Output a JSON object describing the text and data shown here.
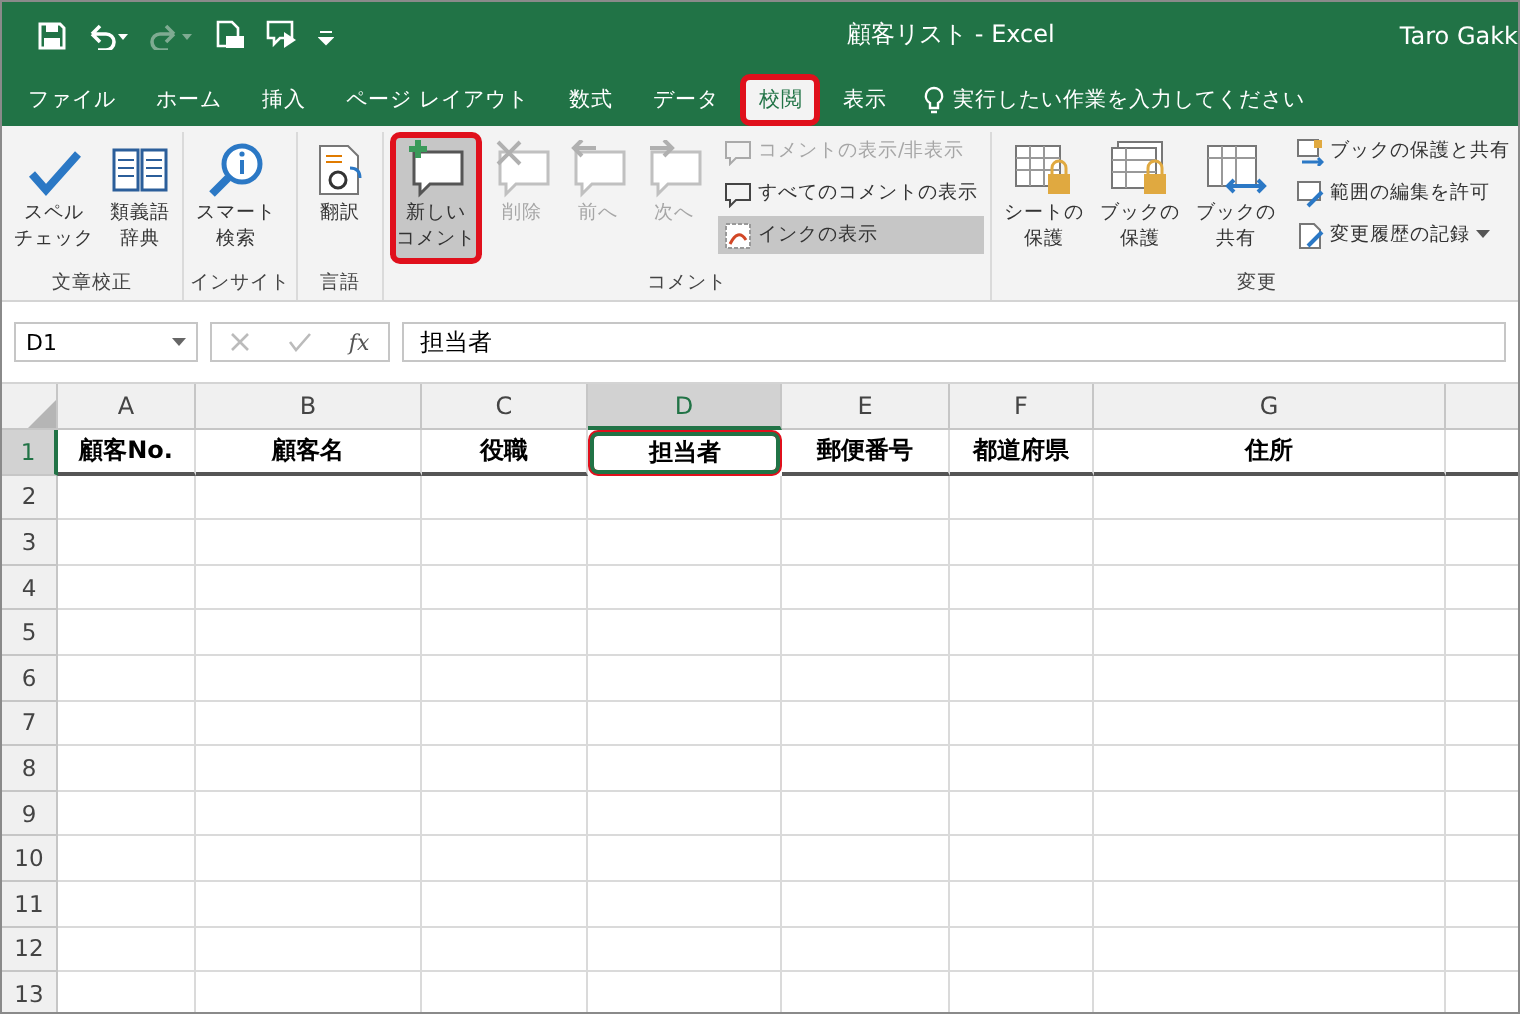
{
  "title_bar": {
    "title": "顧客リスト - Excel",
    "user": "Taro Gakk"
  },
  "tabs": [
    {
      "label": "ファイル",
      "selected": false,
      "highlighted": false
    },
    {
      "label": "ホーム",
      "selected": false,
      "highlighted": false
    },
    {
      "label": "挿入",
      "selected": false,
      "highlighted": false
    },
    {
      "label": "ページ レイアウト",
      "selected": false,
      "highlighted": false
    },
    {
      "label": "数式",
      "selected": false,
      "highlighted": false
    },
    {
      "label": "データ",
      "selected": false,
      "highlighted": false
    },
    {
      "label": "校閲",
      "selected": true,
      "highlighted": true
    },
    {
      "label": "表示",
      "selected": false,
      "highlighted": false
    }
  ],
  "tell_me": "実行したい作業を入力してください",
  "ribbon_groups": [
    {
      "label": "文章校正",
      "items": [
        {
          "kind": "large",
          "lines": [
            "スペル",
            "チェック"
          ],
          "disabled": false,
          "highlighted": false
        },
        {
          "kind": "large",
          "lines": [
            "類義語",
            "辞典"
          ],
          "disabled": false,
          "highlighted": false
        }
      ]
    },
    {
      "label": "インサイト",
      "items": [
        {
          "kind": "large",
          "lines": [
            "スマート",
            "検索"
          ],
          "disabled": false,
          "highlighted": false
        }
      ]
    },
    {
      "label": "言語",
      "items": [
        {
          "kind": "large",
          "lines": [
            "翻訳"
          ],
          "disabled": false,
          "highlighted": false
        }
      ]
    },
    {
      "label": "コメント",
      "items": [
        {
          "kind": "large",
          "lines": [
            "新しい",
            "コメント"
          ],
          "disabled": false,
          "highlighted": true
        },
        {
          "kind": "large",
          "lines": [
            "削除"
          ],
          "disabled": true,
          "highlighted": false
        },
        {
          "kind": "large",
          "lines": [
            "前へ"
          ],
          "disabled": true,
          "highlighted": false
        },
        {
          "kind": "large",
          "lines": [
            "次へ"
          ],
          "disabled": true,
          "highlighted": false
        },
        {
          "kind": "small",
          "label": "コメントの表示/非表示",
          "disabled": true,
          "pressed": false
        },
        {
          "kind": "small",
          "label": "すべてのコメントの表示",
          "disabled": false,
          "pressed": false
        },
        {
          "kind": "small",
          "label": "インクの表示",
          "disabled": false,
          "pressed": true
        }
      ]
    },
    {
      "label": "変更",
      "items": [
        {
          "kind": "large",
          "lines": [
            "シートの",
            "保護"
          ],
          "disabled": false,
          "highlighted": false
        },
        {
          "kind": "large",
          "lines": [
            "ブックの",
            "保護"
          ],
          "disabled": false,
          "highlighted": false
        },
        {
          "kind": "large",
          "lines": [
            "ブックの",
            "共有"
          ],
          "disabled": false,
          "highlighted": false
        },
        {
          "kind": "small",
          "label": "ブックの保護と共有",
          "disabled": false,
          "pressed": false
        },
        {
          "kind": "small",
          "label": "範囲の編集を許可",
          "disabled": false,
          "pressed": false
        },
        {
          "kind": "small",
          "label": "変更履歴の記録",
          "disabled": false,
          "pressed": false,
          "dropdown": true
        }
      ]
    }
  ],
  "formula_bar": {
    "name_box": "D1",
    "fx": "fx",
    "value": "担当者"
  },
  "columns": [
    {
      "label": "A",
      "selected": false
    },
    {
      "label": "B",
      "selected": false
    },
    {
      "label": "C",
      "selected": false
    },
    {
      "label": "D",
      "selected": true
    },
    {
      "label": "E",
      "selected": false
    },
    {
      "label": "F",
      "selected": false
    },
    {
      "label": "G",
      "selected": false
    }
  ],
  "rows": [
    {
      "number": "1",
      "selected": true,
      "cells": [
        {
          "text": "顧客No.",
          "active": false
        },
        {
          "text": "顧客名",
          "active": false
        },
        {
          "text": "役職",
          "active": false
        },
        {
          "text": "担当者",
          "active": true
        },
        {
          "text": "郵便番号",
          "active": false
        },
        {
          "text": "都道府県",
          "active": false
        },
        {
          "text": "住所",
          "active": false
        }
      ]
    },
    {
      "number": "2",
      "selected": false
    },
    {
      "number": "3",
      "selected": false
    },
    {
      "number": "4",
      "selected": false
    },
    {
      "number": "5",
      "selected": false
    },
    {
      "number": "6",
      "selected": false
    },
    {
      "number": "7",
      "selected": false
    },
    {
      "number": "8",
      "selected": false
    },
    {
      "number": "9",
      "selected": false
    },
    {
      "number": "10",
      "selected": false
    },
    {
      "number": "11",
      "selected": false
    },
    {
      "number": "12",
      "selected": false
    },
    {
      "number": "13",
      "selected": false
    }
  ]
}
